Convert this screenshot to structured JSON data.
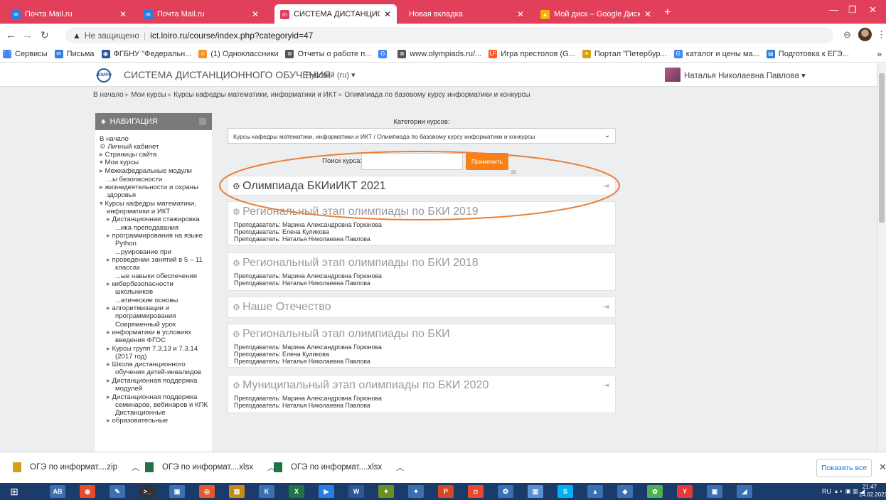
{
  "tabs": [
    {
      "title": "Почта Mail.ru",
      "icon": "mail-icon",
      "color": "#2a7de1"
    },
    {
      "title": "Почта Mail.ru",
      "icon": "mail-icon",
      "color": "#2a7de1"
    },
    {
      "title": "СИСТЕМА ДИСТАНЦИОННОГО",
      "icon": "moodle-icon",
      "color": "#e23f5b"
    },
    {
      "title": "Новая вкладка",
      "icon": "",
      "color": ""
    },
    {
      "title": "Мой диск – Google Диск",
      "icon": "drive-icon",
      "color": "#f4b400"
    }
  ],
  "address": {
    "insecure_label": "Не защищено",
    "url": "ict.loiro.ru/course/index.php?categoryid=47"
  },
  "bookmarks": [
    {
      "label": "Сервисы",
      "color": "#4285f4"
    },
    {
      "label": "Письма",
      "color": "#2a7de1"
    },
    {
      "label": "ФГБНУ \"Федеральн...",
      "color": "#2b5797"
    },
    {
      "label": "(1) Одноклассники",
      "color": "#f7931e"
    },
    {
      "label": "Отчеты о работе п...",
      "color": "#555555"
    },
    {
      "label": "",
      "color": "#4285f4"
    },
    {
      "label": "www.olympiads.ru/...",
      "color": "#555555"
    },
    {
      "label": "Игра престолов (G...",
      "color": "#ff5722"
    },
    {
      "label": "Портал \"Петербур...",
      "color": "#d4a017"
    },
    {
      "label": "каталог и цены ма...",
      "color": "#4285f4"
    },
    {
      "label": "Подготовка к ЕГЭ...",
      "color": "#2a7de1"
    }
  ],
  "site": {
    "title": "СИСТЕМА ДИСТАНЦИОННОГО ОБУЧЕНИЯ",
    "lang": "Русский (ru)",
    "user": "Наталья Николаевна Павлова"
  },
  "breadcrumb": [
    "В начало",
    "Мои курсы",
    "Курсы кафедры математики, информатики и ИКТ",
    "Олимпиада по базовому курсу информатики и конкурсы"
  ],
  "navigation": {
    "header": "НАВИГАЦИЯ",
    "items": [
      {
        "label": "В начало",
        "indent": 0,
        "marker": ""
      },
      {
        "label": "Личный кабинет",
        "indent": 0,
        "marker": "gear"
      },
      {
        "label": "Страницы сайта",
        "indent": 0,
        "marker": "right"
      },
      {
        "label": "Мои курсы",
        "indent": 0,
        "marker": "down"
      },
      {
        "label": "Межкафедральные модули",
        "indent": 1,
        "marker": "right"
      },
      {
        "label": "...ы безопасности",
        "indent": 2,
        "marker": ""
      },
      {
        "label": "жизнедеятельности и охраны",
        "indent": 1,
        "marker": "right"
      },
      {
        "label": "здоровья",
        "indent": 2,
        "marker": ""
      },
      {
        "label": "Курсы кафедры математики,",
        "indent": 1,
        "marker": "down"
      },
      {
        "label": "информатики и ИКТ",
        "indent": 2,
        "marker": ""
      },
      {
        "label": "Дистанционная стажировка",
        "indent": 2,
        "marker": "right"
      },
      {
        "label": "...ика преподавания",
        "indent": 3,
        "marker": ""
      },
      {
        "label": "программирования на языке",
        "indent": 2,
        "marker": "right"
      },
      {
        "label": "Python",
        "indent": 3,
        "marker": ""
      },
      {
        "label": "...руирование при",
        "indent": 3,
        "marker": ""
      },
      {
        "label": "проведении занятий в 5 – 11",
        "indent": 2,
        "marker": "right"
      },
      {
        "label": "классах",
        "indent": 3,
        "marker": ""
      },
      {
        "label": "...ые навыки обеспечения",
        "indent": 3,
        "marker": ""
      },
      {
        "label": "кибербезопасности",
        "indent": 2,
        "marker": "right"
      },
      {
        "label": "школьников",
        "indent": 3,
        "marker": ""
      },
      {
        "label": "...атические основы",
        "indent": 3,
        "marker": ""
      },
      {
        "label": "алгоритмизации и",
        "indent": 2,
        "marker": "right"
      },
      {
        "label": "программирования",
        "indent": 3,
        "marker": ""
      },
      {
        "label": "Современный урок",
        "indent": 3,
        "marker": ""
      },
      {
        "label": "информатики в условиях",
        "indent": 2,
        "marker": "right"
      },
      {
        "label": "введения ФГОС",
        "indent": 3,
        "marker": ""
      },
      {
        "label": "Курсы групп 7.3.13 и 7.3.14",
        "indent": 2,
        "marker": "right"
      },
      {
        "label": "(2017 год)",
        "indent": 3,
        "marker": ""
      },
      {
        "label": "Школа дистанционного",
        "indent": 2,
        "marker": "right"
      },
      {
        "label": "обучения детей-инвалидов",
        "indent": 3,
        "marker": ""
      },
      {
        "label": "Дистанционная поддержка",
        "indent": 2,
        "marker": "right"
      },
      {
        "label": "модулей",
        "indent": 3,
        "marker": ""
      },
      {
        "label": "Дистанционная поддержка",
        "indent": 2,
        "marker": "right"
      },
      {
        "label": "семинаров, вебинаров и КПК",
        "indent": 3,
        "marker": ""
      },
      {
        "label": "Дистанционные",
        "indent": 3,
        "marker": ""
      },
      {
        "label": "образовательные",
        "indent": 2,
        "marker": "right"
      }
    ]
  },
  "category": {
    "label": "Категории курсов:",
    "selected": "Курсы кафедры математики, информатики и ИКТ / Олимпиада по базовому курсу информатики и конкурсы",
    "search_label": "Поиск курса:",
    "search_value": "",
    "apply_button": "Применить"
  },
  "courses": [
    {
      "title": "Олимпиада БКИиИКТ 2021",
      "teachers": [],
      "enroll_icon": true,
      "highlighted": true
    },
    {
      "title": "Региональный этап олимпиады по БКИ 2019",
      "teachers": [
        "Преподаватель: Марина Александровна Горюнова",
        "Преподаватель: Елена Куликова",
        "Преподаватель: Наталья Николаевна Павлова"
      ],
      "enroll_icon": false
    },
    {
      "title": "Региональный этап олимпиады по БКИ 2018",
      "teachers": [
        "Преподаватель: Марина Александровна Горюнова",
        "Преподаватель: Наталья Николаевна Павлова"
      ],
      "enroll_icon": false
    },
    {
      "title": "Наше Отечество",
      "teachers": [],
      "enroll_icon": true
    },
    {
      "title": "Региональный этап олимпиады по БКИ",
      "teachers": [
        "Преподаватель: Марина Александровна Горюнова",
        "Преподаватель: Елена Куликова",
        "Преподаватель: Наталья Николаевна Павлова"
      ],
      "enroll_icon": false
    },
    {
      "title": "Муниципальный этап олимпиады по БКИ 2020",
      "teachers": [
        "Преподаватель: Марина Александровна Горюнова",
        "Преподаватель: Наталья Николаевна Павлова"
      ],
      "enroll_icon": true
    }
  ],
  "downloads": {
    "items": [
      "ОГЭ по информат....zip",
      "ОГЭ по информат....xlsx",
      "ОГЭ по информат....xlsx"
    ],
    "show_all": "Показать все"
  },
  "taskbar": {
    "lang": "RU",
    "time": "21:47",
    "date": "24.02.2021"
  },
  "colors": {
    "accent": "#f98012",
    "tab_strip": "#e23f5b",
    "highlight_ring": "#e8803a",
    "taskbar": "#1b3b6a"
  }
}
